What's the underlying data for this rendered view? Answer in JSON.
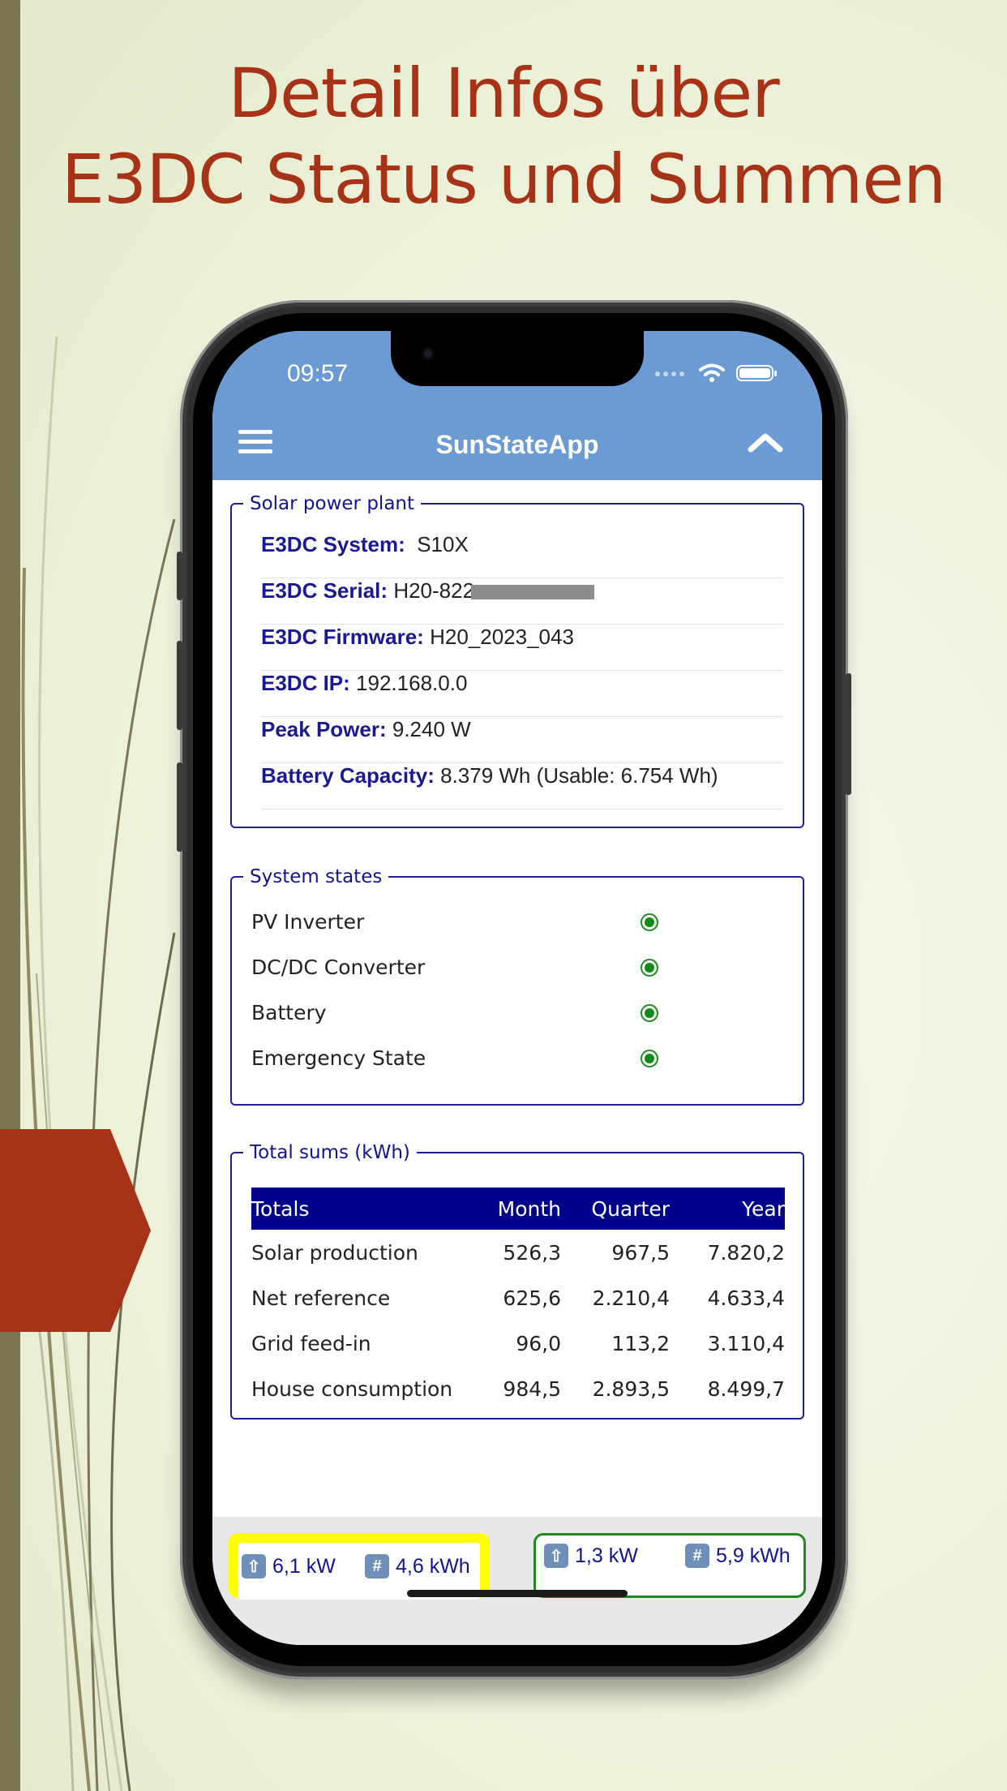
{
  "headline": {
    "line1": "Detail Infos über",
    "line2": "E3DC Status und Summen"
  },
  "status_bar": {
    "time": "09:57"
  },
  "app_bar": {
    "title": "SunStateApp",
    "menu_icon": "hamburger-icon",
    "collapse_icon": "chevron-up-icon"
  },
  "solar_plant": {
    "legend": "Solar power plant",
    "rows": [
      {
        "label": "E3DC System:",
        "value": "S10X"
      },
      {
        "label": "E3DC Serial:",
        "value": "H20-822"
      },
      {
        "label": "E3DC Firmware:",
        "value": "H20_2023_043"
      },
      {
        "label": "E3DC IP:",
        "value": "192.168.0.0"
      },
      {
        "label": "Peak Power:",
        "value": "9.240 W"
      },
      {
        "label": "Battery Capacity:",
        "value": "8.379 Wh (Usable: 6.754 Wh)"
      }
    ]
  },
  "system_states": {
    "legend": "System states",
    "items": [
      {
        "label": "PV Inverter",
        "status": "ok",
        "color": "#138a13"
      },
      {
        "label": "DC/DC Converter",
        "status": "ok",
        "color": "#138a13"
      },
      {
        "label": "Battery",
        "status": "ok",
        "color": "#138a13"
      },
      {
        "label": "Emergency State",
        "status": "ok",
        "color": "#138a13"
      }
    ]
  },
  "totals": {
    "legend": "Total sums (kWh)",
    "columns": [
      "Totals",
      "Month",
      "Quarter",
      "Year"
    ],
    "rows": [
      [
        "Solar production",
        "526,3",
        "967,5",
        "7.820,2"
      ],
      [
        "Net reference",
        "625,6",
        "2.210,4",
        "4.633,4"
      ],
      [
        "Grid feed-in",
        "96,0",
        "113,2",
        "3.110,4"
      ],
      [
        "House consumption",
        "984,5",
        "2.893,5",
        "8.499,7"
      ]
    ]
  },
  "bottom_bar": {
    "left": {
      "power": "6,1 kW",
      "energy": "4,6 kWh",
      "power_icon": "arrow-up-icon",
      "energy_icon": "hash-icon",
      "highlight": "#ffff00"
    },
    "right": {
      "power": "1,3 kW",
      "energy": "5,9 kWh",
      "power_icon": "arrow-up-icon",
      "energy_icon": "hash-icon",
      "border": "#1f8a1f"
    }
  },
  "colors": {
    "accent": "#a63318",
    "app_bar": "#6b9bd2",
    "navy": "#00008a",
    "ok": "#138a13"
  }
}
